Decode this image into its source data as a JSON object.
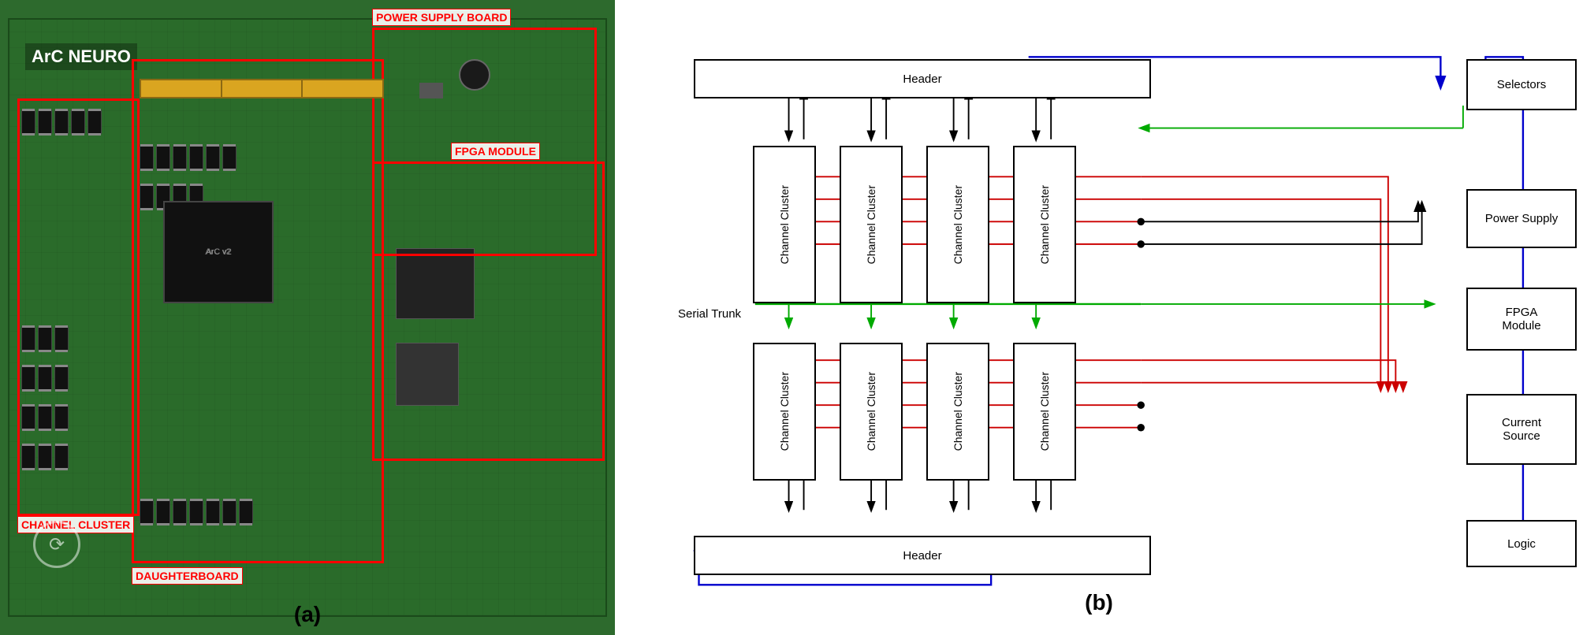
{
  "left": {
    "logo": "ArC NEURO",
    "labels": {
      "channel_cluster": "CHANNEL CLUSTER",
      "daughterboard": "DAUGHTERBOARD",
      "power_supply_board": "POWER SUPPLY BOARD",
      "fpga_module": "FPGA MODULE"
    },
    "caption": "(a)"
  },
  "right": {
    "caption": "(b)",
    "boxes": {
      "header_top": "Header",
      "header_bottom": "Header",
      "selectors": "Selectors",
      "power_supply": "Power Supply",
      "fpga_module": "FPGA\nModule",
      "current_source": "Current\nSource",
      "logic": "Logic",
      "serial_trunk": "Serial Trunk",
      "channel_clusters_top": [
        "Channel\nCluster",
        "Channel\nCluster",
        "Channel\nCluster",
        "Channel\nCluster"
      ],
      "channel_clusters_bottom": [
        "Channel\nCluster",
        "Channel\nCluster",
        "Channel\nCluster",
        "Channel\nCluster"
      ]
    }
  }
}
